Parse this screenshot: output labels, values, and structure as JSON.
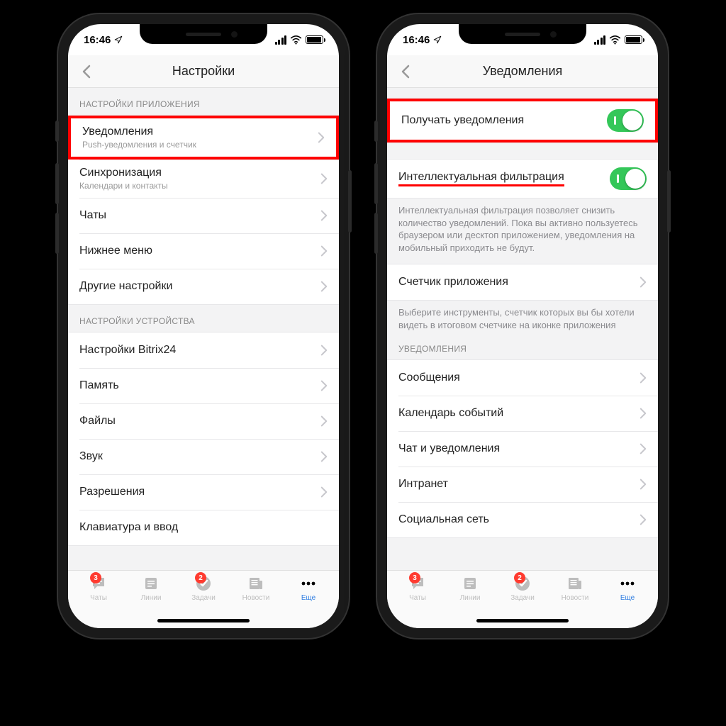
{
  "status": {
    "time": "16:46"
  },
  "left": {
    "title": "Настройки",
    "section1_header": "НАСТРОЙКИ ПРИЛОЖЕНИЯ",
    "rows1": {
      "notifications": {
        "title": "Уведомления",
        "sub": "Push-уведомления и счетчик"
      },
      "sync": {
        "title": "Синхронизация",
        "sub": "Календари и контакты"
      },
      "chats": "Чаты",
      "bottom_menu": "Нижнее меню",
      "other": "Другие настройки"
    },
    "section2_header": "НАСТРОЙКИ УСТРОЙСТВА",
    "rows2": {
      "bitrix": "Настройки Bitrix24",
      "memory": "Память",
      "files": "Файлы",
      "sound": "Звук",
      "permissions": "Разрешения",
      "keyboard": "Клавиатура и ввод"
    }
  },
  "right": {
    "title": "Уведомления",
    "receive": "Получать уведомления",
    "smart_filter": "Интеллектуальная фильтрация",
    "smart_filter_note": "Интеллектуальная фильтрация позволяет снизить количество уведомлений. Пока вы активно пользуетесь браузером или десктоп приложением, уведомления на мобильный приходить не будут.",
    "counter": "Счетчик приложения",
    "counter_note": "Выберите инструменты, счетчик которых вы бы хотели видеть в итоговом счетчике на иконке приложения",
    "section_notif": "УВЕДОМЛЕНИЯ",
    "n_rows": {
      "messages": "Сообщения",
      "calendar": "Календарь событий",
      "chat": "Чат и уведомления",
      "intranet": "Интранет",
      "social": "Социальная сеть"
    }
  },
  "tabs": {
    "chats": {
      "label": "Чаты",
      "badge": "3"
    },
    "lines": {
      "label": "Линии"
    },
    "tasks": {
      "label": "Задачи",
      "badge": "2"
    },
    "news": {
      "label": "Новости"
    },
    "more": {
      "label": "Еще"
    }
  }
}
